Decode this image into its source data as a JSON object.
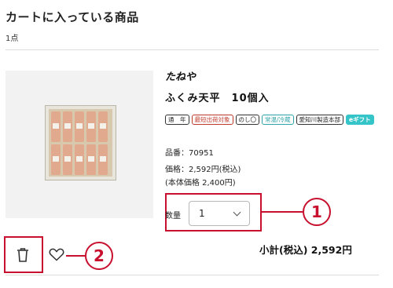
{
  "cart": {
    "title": "カートに入っている商品",
    "count": "1点"
  },
  "item": {
    "brand": "たねや",
    "name": "ふくみ天平　10個入",
    "tags": [
      {
        "label": "通　年",
        "style": "default"
      },
      {
        "label": "最短出荷対象",
        "style": "red"
      },
      {
        "label": "のし〇",
        "style": "default"
      },
      {
        "label": "常温/冷蔵",
        "style": "teal"
      },
      {
        "label": "愛知川製造本部",
        "style": "default"
      },
      {
        "label": "eギフト",
        "style": "gift"
      }
    ],
    "sku": "品番：70951",
    "price": "価格：2,592円(税込)",
    "price_base": "(本体価格 2,400円)",
    "quantity_label": "数量",
    "quantity_value": "1",
    "subtotal": "小計(税込) 2,592円"
  },
  "annotations": {
    "callout_1": "1",
    "callout_2": "2"
  },
  "colors": {
    "annotation_red": "#c8102e",
    "gift_teal": "#35c4c8"
  },
  "icons": {
    "delete": "trash-icon",
    "favorite": "heart-icon"
  }
}
